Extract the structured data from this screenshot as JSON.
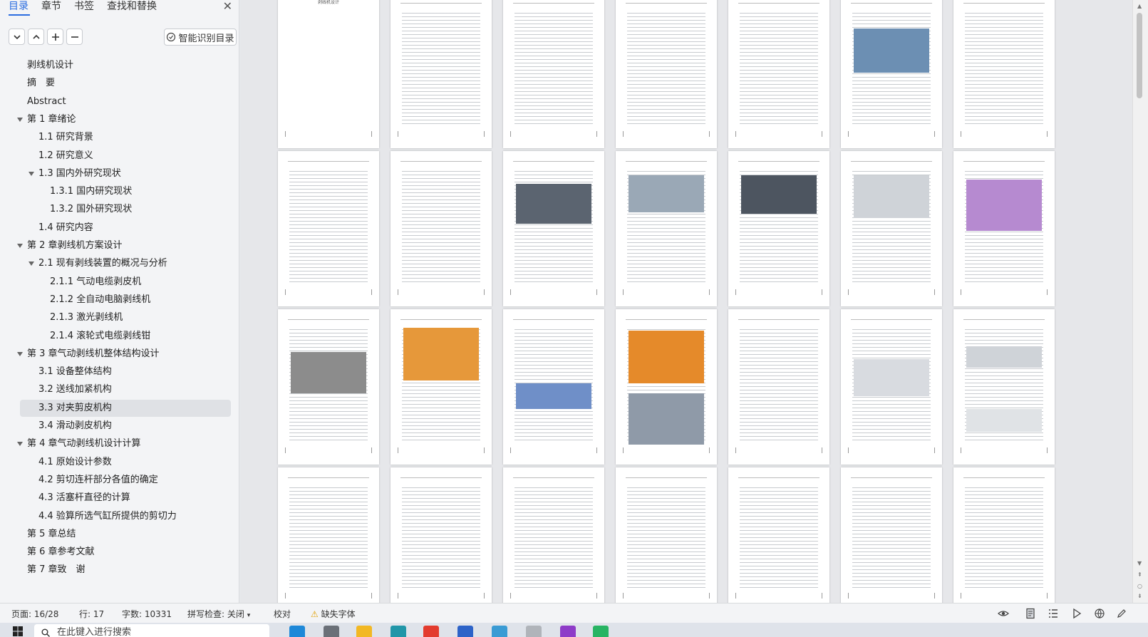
{
  "tabs": [
    "目录",
    "章节",
    "书签",
    "查找和替换"
  ],
  "toc_toolbar": {
    "smart_toc_label": "智能识别目录"
  },
  "toc": [
    {
      "label": "剥线机设计",
      "level": 1,
      "expanded": null
    },
    {
      "label": "摘　要",
      "level": 1,
      "expanded": null
    },
    {
      "label": "Abstract",
      "level": 1,
      "expanded": null
    },
    {
      "label": "第 1 章绪论",
      "level": 1,
      "expanded": true
    },
    {
      "label": "1.1  研究背景",
      "level": 2,
      "expanded": null
    },
    {
      "label": "1.2  研究意义",
      "level": 2,
      "expanded": null
    },
    {
      "label": "1.3  国内外研究现状",
      "level": 2,
      "expanded": true
    },
    {
      "label": "1.3.1  国内研究现状",
      "level": 3,
      "expanded": null
    },
    {
      "label": "1.3.2  国外研究现状",
      "level": 3,
      "expanded": null
    },
    {
      "label": "1.4  研究内容",
      "level": 2,
      "expanded": null
    },
    {
      "label": "第 2 章剥线机方案设计",
      "level": 1,
      "expanded": true
    },
    {
      "label": "2.1  现有剥线装置的概况与分析",
      "level": 2,
      "expanded": true
    },
    {
      "label": "2.1.1  气动电缆剥皮机",
      "level": 3,
      "expanded": null
    },
    {
      "label": "2.1.2  全自动电脑剥线机",
      "level": 3,
      "expanded": null
    },
    {
      "label": "2.1.3  激光剥线机",
      "level": 3,
      "expanded": null
    },
    {
      "label": "2.1.4  滚轮式电缆剥线钳",
      "level": 3,
      "expanded": null
    },
    {
      "label": "第 3 章气动剥线机整体结构设计",
      "level": 1,
      "expanded": true
    },
    {
      "label": "3.1  设备整体结构",
      "level": 2,
      "expanded": null
    },
    {
      "label": "3.2  送线加紧机构",
      "level": 2,
      "expanded": null
    },
    {
      "label": "3.3  对夹剪皮机构",
      "level": 2,
      "expanded": null,
      "selected": true
    },
    {
      "label": "3.4  滑动剥皮机构",
      "level": 2,
      "expanded": null
    },
    {
      "label": "第 4 章气动剥线机设计计算",
      "level": 1,
      "expanded": true
    },
    {
      "label": "4.1  原始设计参数",
      "level": 2,
      "expanded": null
    },
    {
      "label": "4.2  剪切连杆部分各值的确定",
      "level": 2,
      "expanded": null
    },
    {
      "label": "4.3  活塞杆直径的计算",
      "level": 2,
      "expanded": null
    },
    {
      "label": "4.4  验算所选气缸所提供的剪切力",
      "level": 2,
      "expanded": null
    },
    {
      "label": "第 5 章总结",
      "level": 1,
      "expanded": null
    },
    {
      "label": "第 6 章参考文献",
      "level": 1,
      "expanded": null
    },
    {
      "label": "第 7 章致　谢",
      "level": 1,
      "expanded": null
    }
  ],
  "first_page_title": "剥线机设计",
  "status": {
    "page": "页面: 16/28",
    "line": "行: 17",
    "words": "字数: 10331",
    "spellcheck": "拼写检查: 关闭",
    "proof": "校对",
    "missing_font": "缺失字体"
  },
  "taskbar": {
    "search_placeholder": "在此键入进行搜索"
  },
  "colors": {
    "accent": "#2b6de0",
    "panel_bg": "#f3f4f6",
    "selected_bg": "#dfe1e5"
  }
}
